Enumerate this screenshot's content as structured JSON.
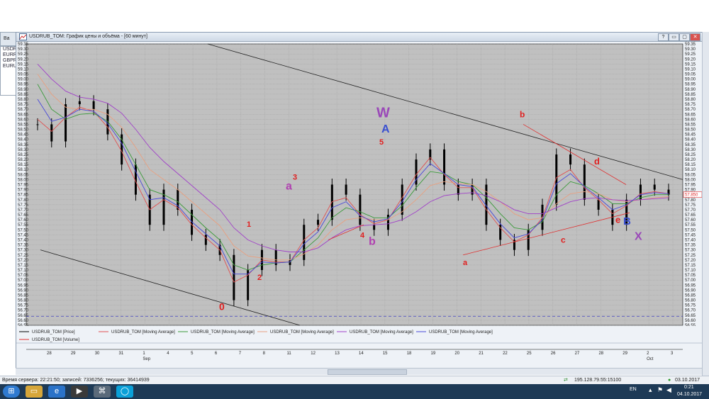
{
  "side_panel": {
    "header": "Ва",
    "items": [
      "USDRU",
      "EURR",
      "GBPR",
      "EURU"
    ]
  },
  "window": {
    "title": "USDRUB_TOM: График цены и объёма - [60 минут]",
    "buttons": [
      "?",
      "▭",
      "▢",
      "✕"
    ]
  },
  "chart_data": {
    "type": "line",
    "title": "",
    "ylim": [
      56.55,
      59.35
    ],
    "y_ticks": [
      "59.35",
      "59.30",
      "59.25",
      "59.20",
      "59.15",
      "59.10",
      "59.05",
      "59.00",
      "58.95",
      "58.90",
      "58.85",
      "58.80",
      "58.75",
      "58.70",
      "58.65",
      "58.60",
      "58.55",
      "58.50",
      "58.45",
      "58.40",
      "58.35",
      "58.30",
      "58.25",
      "58.20",
      "58.15",
      "58.10",
      "58.05",
      "58.00",
      "57.95",
      "57.90",
      "57.85",
      "57.80",
      "57.75",
      "57.70",
      "57.65",
      "57.60",
      "57.55",
      "57.50",
      "57.45",
      "57.40",
      "57.35",
      "57.30",
      "57.25",
      "57.20",
      "57.15",
      "57.10",
      "57.05",
      "57.00",
      "56.95",
      "56.90",
      "56.85",
      "56.80",
      "56.75",
      "56.70",
      "56.65",
      "56.60",
      "56.55"
    ],
    "x_ticks": [
      "28",
      "29",
      "30",
      "31",
      "1",
      "4",
      "5",
      "6",
      "7",
      "8",
      "11",
      "12",
      "13",
      "14",
      "15",
      "18",
      "19",
      "20",
      "21",
      "22",
      "25",
      "26",
      "27",
      "28",
      "29",
      "2",
      "3"
    ],
    "x_month_labels": [
      "Sep",
      "Oct"
    ],
    "last_price_label": "57.850",
    "series": [
      {
        "name": "USDRUB_TOM [Price]",
        "color": "#000000",
        "values": [
          58.55,
          58.38,
          58.75,
          58.78,
          58.7,
          58.45,
          58.15,
          57.85,
          57.55,
          57.9,
          57.7,
          57.45,
          57.35,
          57.25,
          56.8,
          57.1,
          57.3,
          57.15,
          57.2,
          57.55,
          57.6,
          57.95,
          57.85,
          57.55,
          57.5,
          57.65,
          57.95,
          58.2,
          58.3,
          57.95,
          57.85,
          57.95,
          57.55,
          57.4,
          57.3,
          57.5,
          57.75,
          58.25,
          58.15,
          57.8,
          57.7,
          57.55,
          57.8,
          57.95,
          57.9,
          57.85
        ]
      },
      {
        "name": "USDRUB_TOM [Moving Average]",
        "color": "#e05050",
        "values": [
          58.6,
          58.48,
          58.62,
          58.72,
          58.68,
          58.52,
          58.28,
          57.98,
          57.7,
          57.8,
          57.72,
          57.55,
          57.42,
          57.3,
          56.98,
          57.05,
          57.2,
          57.18,
          57.18,
          57.4,
          57.52,
          57.78,
          57.82,
          57.65,
          57.56,
          57.6,
          57.82,
          58.05,
          58.22,
          58.05,
          57.92,
          57.92,
          57.7,
          57.52,
          57.38,
          57.45,
          57.62,
          58.02,
          58.1,
          57.92,
          57.8,
          57.66,
          57.74,
          57.86,
          57.88,
          57.86
        ]
      },
      {
        "name": "USDRUB_TOM [Moving Average]",
        "color": "#3a9a3a",
        "values": [
          58.95,
          58.7,
          58.6,
          58.65,
          58.66,
          58.58,
          58.4,
          58.15,
          57.9,
          57.85,
          57.78,
          57.65,
          57.52,
          57.4,
          57.15,
          57.1,
          57.15,
          57.17,
          57.18,
          57.3,
          57.42,
          57.62,
          57.72,
          57.68,
          57.62,
          57.62,
          57.74,
          57.92,
          58.08,
          58.06,
          57.98,
          57.95,
          57.82,
          57.66,
          57.52,
          57.5,
          57.58,
          57.85,
          57.98,
          57.94,
          57.86,
          57.76,
          57.76,
          57.82,
          57.85,
          57.85
        ]
      },
      {
        "name": "USDRUB_TOM [Moving Average]",
        "color": "#e8a080",
        "values": [
          59.05,
          58.85,
          58.72,
          58.7,
          58.7,
          58.65,
          58.52,
          58.32,
          58.1,
          58.0,
          57.9,
          57.78,
          57.66,
          57.54,
          57.34,
          57.24,
          57.22,
          57.2,
          57.2,
          57.26,
          57.35,
          57.5,
          57.6,
          57.62,
          57.6,
          57.6,
          57.68,
          57.8,
          57.94,
          57.98,
          57.96,
          57.95,
          57.88,
          57.78,
          57.66,
          57.6,
          57.62,
          57.76,
          57.86,
          57.88,
          57.86,
          57.8,
          57.78,
          57.8,
          57.82,
          57.83
        ]
      },
      {
        "name": "USDRUB_TOM [Moving Average]",
        "color": "#a040c8",
        "values": [
          59.15,
          59.0,
          58.88,
          58.82,
          58.8,
          58.76,
          58.66,
          58.5,
          58.32,
          58.18,
          58.06,
          57.94,
          57.82,
          57.7,
          57.52,
          57.4,
          57.34,
          57.3,
          57.28,
          57.28,
          57.32,
          57.42,
          57.5,
          57.54,
          57.55,
          57.56,
          57.6,
          57.68,
          57.78,
          57.84,
          57.86,
          57.87,
          57.84,
          57.78,
          57.7,
          57.66,
          57.66,
          57.72,
          57.78,
          57.81,
          57.82,
          57.8,
          57.79,
          57.8,
          57.81,
          57.82
        ]
      },
      {
        "name": "USDRUB_TOM [Moving Average]",
        "color": "#4848d8",
        "values": [
          58.8,
          58.58,
          58.62,
          58.7,
          58.68,
          58.56,
          58.36,
          58.08,
          57.8,
          57.82,
          57.74,
          57.58,
          57.46,
          57.34,
          57.06,
          57.06,
          57.18,
          57.17,
          57.18,
          57.36,
          57.48,
          57.72,
          57.78,
          57.64,
          57.58,
          57.61,
          57.78,
          58.0,
          58.16,
          58.06,
          57.95,
          57.93,
          57.74,
          57.56,
          57.42,
          57.46,
          57.6,
          57.96,
          58.06,
          57.93,
          57.82,
          57.7,
          57.75,
          57.85,
          57.87,
          57.86
        ]
      }
    ],
    "volume_series_name": "USDRUB_TOM [Volume]",
    "annotations": [
      {
        "text": "0",
        "color": "#e02020"
      },
      {
        "text": "1",
        "color": "#e02020"
      },
      {
        "text": "2",
        "color": "#e02020"
      },
      {
        "text": "3",
        "color": "#e02020"
      },
      {
        "text": "4",
        "color": "#e02020"
      },
      {
        "text": "5",
        "color": "#e02020"
      },
      {
        "text": "a",
        "color": "#b040b0"
      },
      {
        "text": "b",
        "color": "#b040b0"
      },
      {
        "text": "W",
        "color": "#9a48b8"
      },
      {
        "text": "A",
        "color": "#3a50d0"
      },
      {
        "text": "a",
        "color": "#e02020"
      },
      {
        "text": "b",
        "color": "#e02020"
      },
      {
        "text": "c",
        "color": "#e02020"
      },
      {
        "text": "d",
        "color": "#e02020"
      },
      {
        "text": "e",
        "color": "#e02020"
      },
      {
        "text": "B",
        "color": "#3a50d0"
      },
      {
        "text": "X",
        "color": "#9a48b8"
      }
    ],
    "grid": true,
    "background": "#c0c0c0"
  },
  "status": {
    "text": "Время сервера: 22:21:50; записей: 7336256; текущих: 36414939",
    "ip": "195.128.79.55:15100",
    "date": "03.10.2017"
  },
  "taskbar": {
    "lang": "EN",
    "time": "0:21",
    "date": "04.10.2017",
    "icons": [
      "start-orb",
      "folder",
      "ie",
      "media",
      "network",
      "app"
    ]
  }
}
